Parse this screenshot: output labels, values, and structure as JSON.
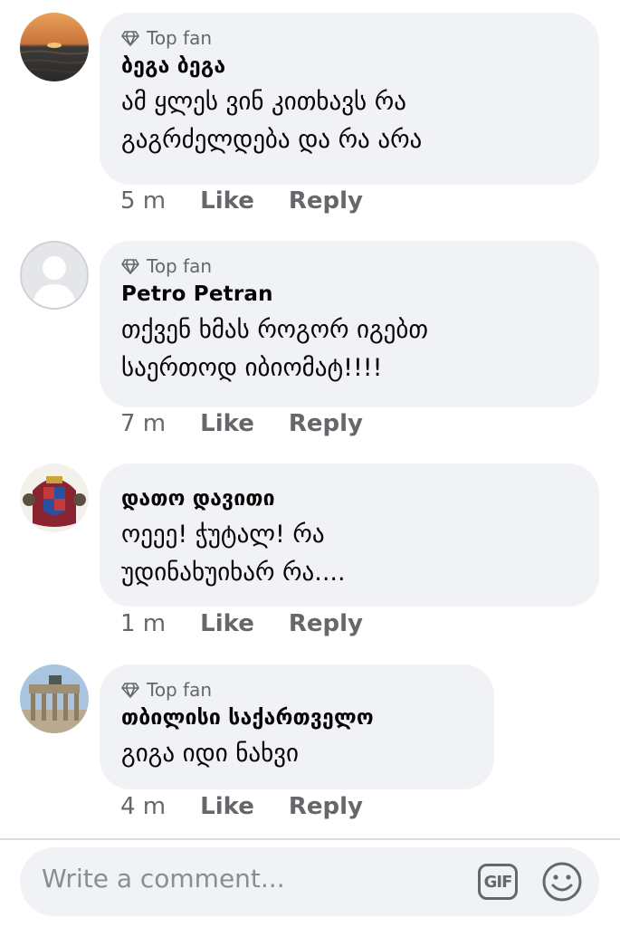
{
  "comments": [
    {
      "badge": "Top fan",
      "author": "ბეგა ბეგა",
      "lines": [
        "ამ ყლეს ვინ კითხავს რა",
        "გაგრძელდება და რა არა"
      ],
      "time": "5 m",
      "like": "Like",
      "reply": "Reply",
      "avatar": "sunset-photo"
    },
    {
      "badge": "Top fan",
      "author": "Petro Petran",
      "lines": [
        "თქვენ ხმას როგორ იგებთ",
        "საერთოდ იბიომატ!!!!"
      ],
      "time": "7 m",
      "like": "Like",
      "reply": "Reply",
      "avatar": "default-silhouette"
    },
    {
      "badge": "",
      "author": "დათო დავითი",
      "lines": [
        "ოეეე! ჭუტალ! რა",
        "უდინახუიხარ რა...."
      ],
      "time": "1 m",
      "like": "Like",
      "reply": "Reply",
      "avatar": "coat-of-arms"
    },
    {
      "badge": "Top fan",
      "author": "თბილისი საქართველო",
      "lines": [
        "გიგა იდი ნახვი"
      ],
      "time": "4 m",
      "like": "Like",
      "reply": "Reply",
      "avatar": "gate-photo"
    }
  ],
  "composer": {
    "placeholder": "Write a comment...",
    "gif_label": "GIF",
    "emoji_icon": "smiley-icon"
  },
  "colors": {
    "bubble": "#f0f2f5",
    "secondary_text": "#65676b",
    "primary_text": "#050505"
  }
}
